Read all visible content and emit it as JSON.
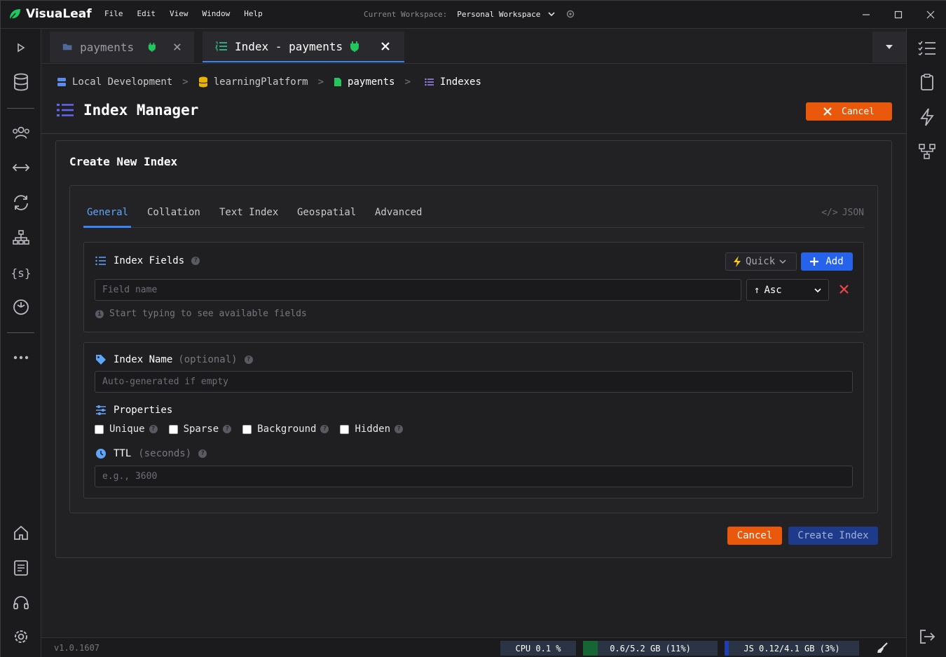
{
  "app": {
    "name": "VisuaLeaf",
    "brand_color": "#22c55e"
  },
  "menu": [
    "File",
    "Edit",
    "View",
    "Window",
    "Help"
  ],
  "workspace": {
    "label": "Current Workspace:",
    "value": "Personal Workspace"
  },
  "tabs": [
    {
      "label": "payments",
      "icon": "folder-open-icon"
    },
    {
      "label": "Index - payments",
      "icon": "list-ordered-icon"
    }
  ],
  "breadcrumb": [
    {
      "label": "Local Development",
      "icon": "server-icon"
    },
    {
      "label": "learningPlatform",
      "icon": "database-icon"
    },
    {
      "label": "payments",
      "icon": "file-icon"
    },
    {
      "label": "Indexes",
      "icon": "list-icon"
    }
  ],
  "page": {
    "title": "Index Manager",
    "cancel_label": "Cancel"
  },
  "panel": {
    "title": "Create New Index",
    "tabs": [
      "General",
      "Collation",
      "Text Index",
      "Geospatial",
      "Advanced"
    ],
    "active_tab": "General",
    "json_label": "JSON",
    "index_fields": {
      "title": "Index Fields",
      "quick_label": "Quick",
      "add_label": "Add",
      "field_placeholder": "Field name",
      "order_value": "Asc",
      "hint": "Start typing to see available fields"
    },
    "index_name": {
      "title": "Index Name",
      "optional": "(optional)",
      "placeholder": "Auto-generated if empty"
    },
    "properties": {
      "title": "Properties",
      "options": [
        "Unique",
        "Sparse",
        "Background",
        "Hidden"
      ]
    },
    "ttl": {
      "title": "TTL",
      "unit": "(seconds)",
      "placeholder": "e.g., 3600"
    },
    "cancel_label": "Cancel",
    "create_label": "Create Index"
  },
  "status": {
    "version": "v1.0.1607",
    "cpu": "CPU 0.1 %",
    "memory": "0.6/5.2 GB (11%)",
    "memory_fraction": 0.11,
    "js": "JS 0.12/4.1 GB (3%)",
    "js_fraction": 0.03
  },
  "colors": {
    "accent": "#3b82f6",
    "danger": "#ea580c",
    "success": "#22c55e"
  }
}
